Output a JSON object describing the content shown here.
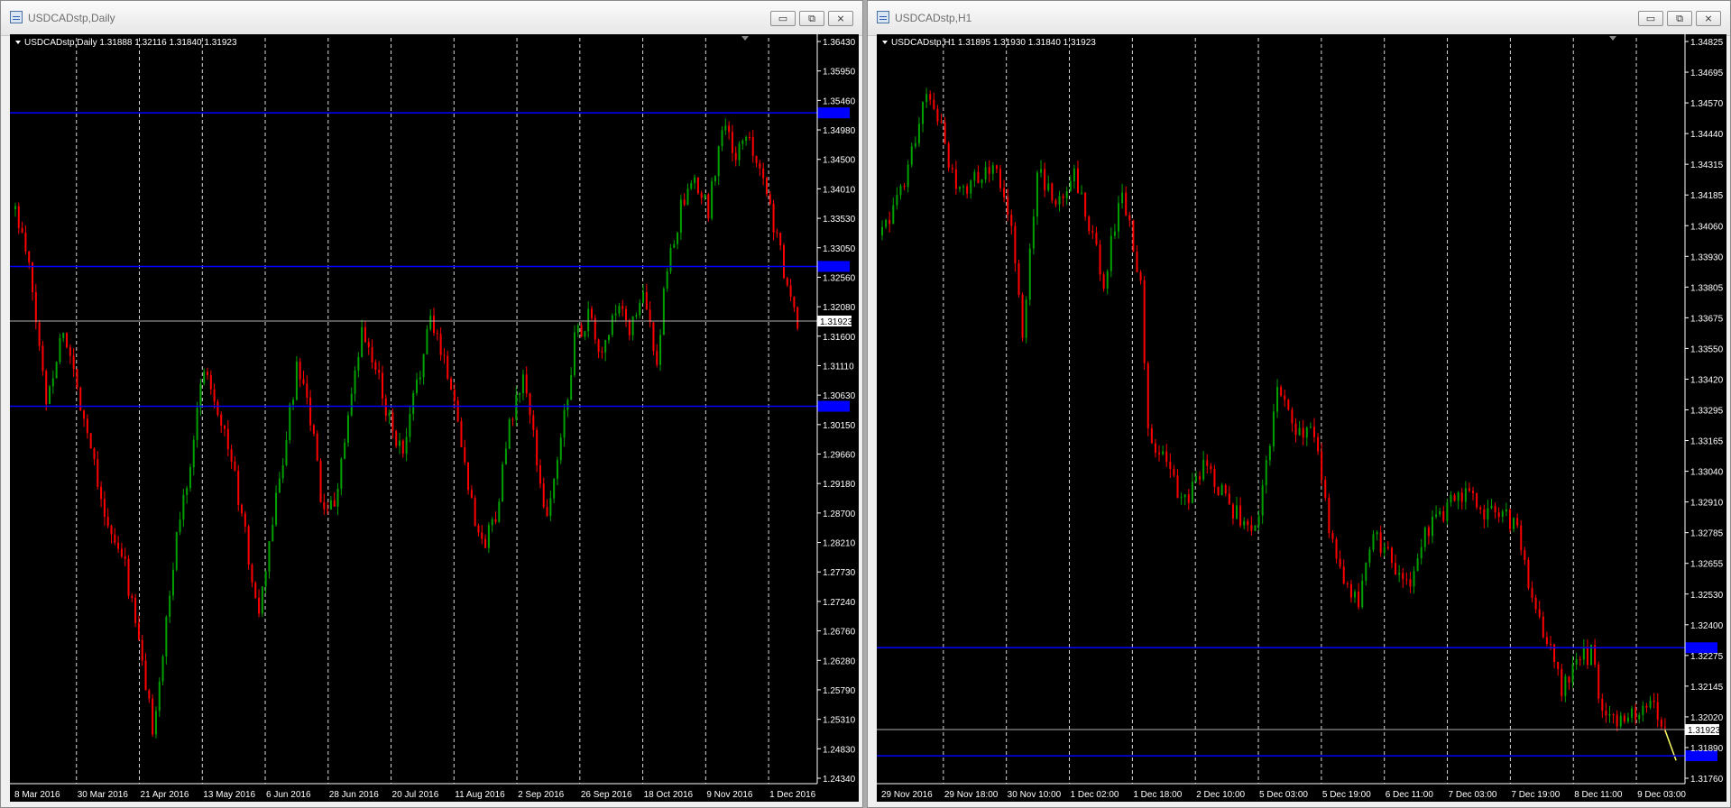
{
  "windows": [
    {
      "id": "daily",
      "title": "USDCADstp,Daily",
      "controls": {
        "minimize": "▭",
        "maximize": "⧉",
        "close": "⨯"
      },
      "chart_data": {
        "type": "candlestick",
        "info_line": "USDCADstp,Daily  1.31888 1.32116 1.31840 1.31923",
        "ylim": [
          1.2415,
          1.3668
        ],
        "y_ticks": [
          "1.36430",
          "1.35950",
          "1.35460",
          "1.34980",
          "1.34500",
          "1.34010",
          "1.33530",
          "1.33050",
          "1.32560",
          "1.32080",
          "1.31600",
          "1.31110",
          "1.30630",
          "1.30150",
          "1.29660",
          "1.29180",
          "1.28700",
          "1.28210",
          "1.27730",
          "1.27240",
          "1.26760",
          "1.26280",
          "1.25790",
          "1.25310",
          "1.24830",
          "1.24340"
        ],
        "x_labels": [
          "8 Mar 2016",
          "30 Mar 2016",
          "21 Apr 2016",
          "13 May 2016",
          "6 Jun 2016",
          "28 Jun 2016",
          "20 Jul 2016",
          "11 Aug 2016",
          "2 Sep 2016",
          "26 Sep 2016",
          "18 Oct 2016",
          "9 Nov 2016",
          "1 Dec 2016"
        ],
        "current_price": "1.31923",
        "current_price_value": 1.31923,
        "hlines": [
          1.3542,
          1.3284,
          1.3049
        ],
        "waypoints": [
          [
            0,
            1.338
          ],
          [
            4,
            1.328
          ],
          [
            9,
            1.306
          ],
          [
            14,
            1.318
          ],
          [
            18,
            1.308
          ],
          [
            23,
            1.296
          ],
          [
            27,
            1.284
          ],
          [
            32,
            1.278
          ],
          [
            36,
            1.265
          ],
          [
            40,
            1.251
          ],
          [
            43,
            1.263
          ],
          [
            47,
            1.283
          ],
          [
            51,
            1.296
          ],
          [
            55,
            1.312
          ],
          [
            59,
            1.305
          ],
          [
            63,
            1.296
          ],
          [
            67,
            1.283
          ],
          [
            71,
            1.269
          ],
          [
            74,
            1.282
          ],
          [
            78,
            1.296
          ],
          [
            82,
            1.311
          ],
          [
            86,
            1.303
          ],
          [
            90,
            1.286
          ],
          [
            93,
            1.289
          ],
          [
            97,
            1.302
          ],
          [
            101,
            1.317
          ],
          [
            105,
            1.311
          ],
          [
            109,
            1.303
          ],
          [
            113,
            1.296
          ],
          [
            117,
            1.309
          ],
          [
            121,
            1.319
          ],
          [
            124,
            1.315
          ],
          [
            128,
            1.306
          ],
          [
            132,
            1.292
          ],
          [
            136,
            1.281
          ],
          [
            140,
            1.287
          ],
          [
            144,
            1.301
          ],
          [
            148,
            1.31
          ],
          [
            152,
            1.296
          ],
          [
            155,
            1.286
          ],
          [
            159,
            1.299
          ],
          [
            163,
            1.316
          ],
          [
            167,
            1.32
          ],
          [
            171,
            1.313
          ],
          [
            175,
            1.321
          ],
          [
            179,
            1.318
          ],
          [
            183,
            1.323
          ],
          [
            187,
            1.313
          ],
          [
            190,
            1.328
          ],
          [
            194,
            1.338
          ],
          [
            198,
            1.342
          ],
          [
            202,
            1.338
          ],
          [
            206,
            1.352
          ],
          [
            210,
            1.347
          ],
          [
            214,
            1.35
          ],
          [
            218,
            1.344
          ],
          [
            222,
            1.333
          ],
          [
            226,
            1.322
          ],
          [
            228,
            1.3192
          ]
        ],
        "seed": 11
      }
    },
    {
      "id": "h1",
      "title": "USDCADstp,H1",
      "controls": {
        "minimize": "▭",
        "maximize": "⧉",
        "close": "⨯"
      },
      "chart_data": {
        "type": "candlestick",
        "info_line": "USDCADstp,H1  1.31895 1.31930 1.31840 1.31923",
        "ylim": [
          1.3169,
          1.349
        ],
        "y_ticks": [
          "1.34825",
          "1.34695",
          "1.34570",
          "1.34440",
          "1.34315",
          "1.34185",
          "1.34060",
          "1.33930",
          "1.33805",
          "1.33675",
          "1.33550",
          "1.33420",
          "1.33295",
          "1.33165",
          "1.33040",
          "1.32910",
          "1.32785",
          "1.32655",
          "1.32530",
          "1.32400",
          "1.32275",
          "1.32145",
          "1.32020",
          "1.31890",
          "1.31760"
        ],
        "x_labels": [
          "29 Nov 2016",
          "29 Nov 18:00",
          "30 Nov 10:00",
          "1 Dec 02:00",
          "1 Dec 18:00",
          "2 Dec 10:00",
          "5 Dec 03:00",
          "5 Dec 19:00",
          "6 Dec 11:00",
          "7 Dec 03:00",
          "7 Dec 19:00",
          "8 Dec 11:00",
          "9 Dec 03:00"
        ],
        "current_price": "1.31923",
        "current_price_value": 1.31923,
        "hlines": [
          1.32275,
          1.3181
        ],
        "waypoints": [
          [
            0,
            1.3405
          ],
          [
            6,
            1.343
          ],
          [
            12,
            1.3465
          ],
          [
            16,
            1.345
          ],
          [
            20,
            1.3422
          ],
          [
            25,
            1.343
          ],
          [
            30,
            1.3437
          ],
          [
            35,
            1.341
          ],
          [
            38,
            1.3362
          ],
          [
            42,
            1.3435
          ],
          [
            47,
            1.3418
          ],
          [
            52,
            1.3432
          ],
          [
            56,
            1.341
          ],
          [
            60,
            1.3385
          ],
          [
            65,
            1.3425
          ],
          [
            70,
            1.3385
          ],
          [
            72,
            1.3318
          ],
          [
            77,
            1.3305
          ],
          [
            82,
            1.329
          ],
          [
            87,
            1.3305
          ],
          [
            92,
            1.3295
          ],
          [
            97,
            1.3282
          ],
          [
            102,
            1.3282
          ],
          [
            107,
            1.3338
          ],
          [
            112,
            1.332
          ],
          [
            117,
            1.3318
          ],
          [
            121,
            1.328
          ],
          [
            125,
            1.3255
          ],
          [
            129,
            1.3245
          ],
          [
            133,
            1.3275
          ],
          [
            138,
            1.3265
          ],
          [
            143,
            1.3255
          ],
          [
            147,
            1.3278
          ],
          [
            152,
            1.3285
          ],
          [
            156,
            1.3295
          ],
          [
            160,
            1.329
          ],
          [
            164,
            1.3285
          ],
          [
            168,
            1.3285
          ],
          [
            172,
            1.3278
          ],
          [
            176,
            1.3245
          ],
          [
            180,
            1.323
          ],
          [
            184,
            1.321
          ],
          [
            188,
            1.3222
          ],
          [
            192,
            1.3225
          ],
          [
            196,
            1.3195
          ],
          [
            200,
            1.3198
          ],
          [
            204,
            1.3198
          ],
          [
            208,
            1.3208
          ],
          [
            212,
            1.3192
          ]
        ],
        "tail_line": [
          [
            212,
            1.3192
          ],
          [
            214,
            1.3179
          ]
        ],
        "seed": 29
      }
    }
  ],
  "colors": {
    "background": "#000000",
    "bull": "#00a000",
    "bear": "#ff0000",
    "wick_bull": "#00a000",
    "wick_bear": "#ff0000",
    "grid": "#ffffff",
    "hline": "#0000ff",
    "price_line": "#b0b0b0",
    "axis_text": "#ffffff",
    "tail": "#ffff66"
  }
}
